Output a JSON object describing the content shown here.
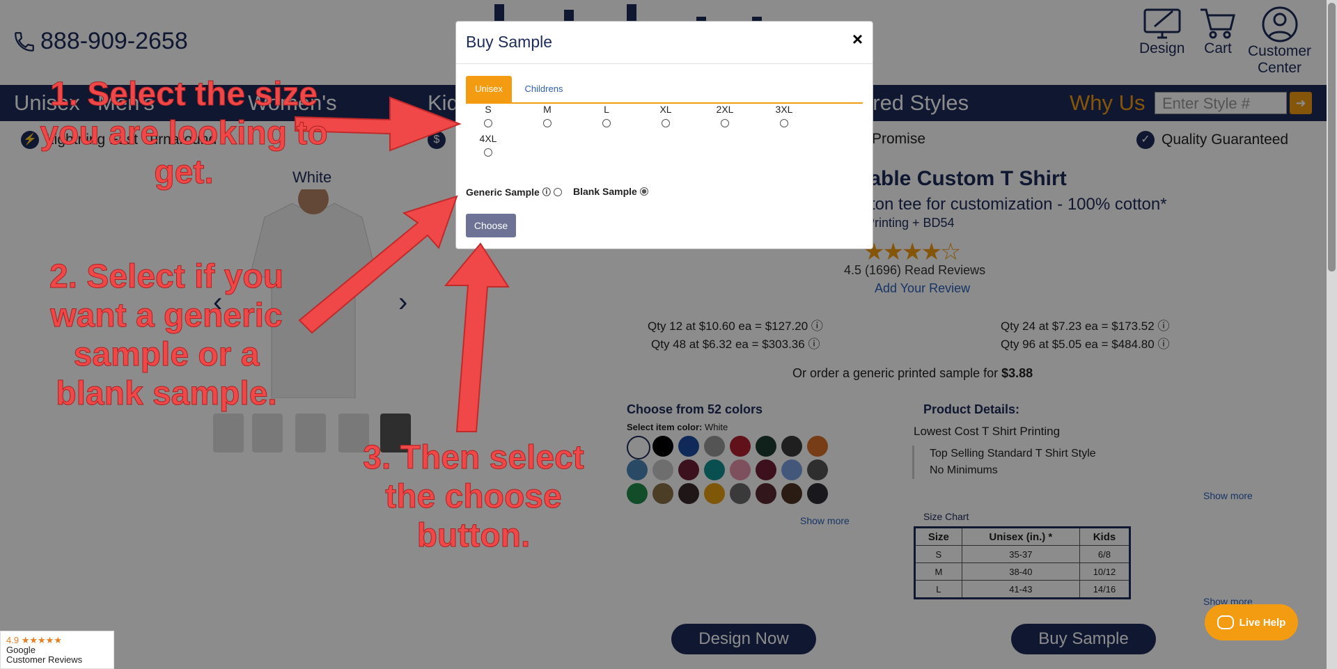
{
  "header": {
    "phone": "888-909-2658",
    "icons": [
      {
        "label": "Design",
        "icon": "design-monitor-icon"
      },
      {
        "label": "Cart",
        "icon": "cart-icon"
      },
      {
        "label_line1": "Customer",
        "label_line2": "Center",
        "icon": "user-icon"
      }
    ]
  },
  "nav": {
    "items": [
      "Unisex",
      "Men's",
      "Women's",
      "Kids",
      "ered Styles"
    ],
    "why_us": "Why Us",
    "search_placeholder": "Enter Style #"
  },
  "benefits": [
    "Lightning Fast Turnaround",
    "Promise",
    "Quality Guaranteed"
  ],
  "product": {
    "color_label": "White",
    "title": "dable Custom T Shirt",
    "subtitle": "otton tee for customization - 100% cotton*",
    "subtitle2": "lt Printing + BD54",
    "rating": 4.5,
    "reviews": "4.5 (1696) Read Reviews",
    "add_review": "Add Your Review",
    "qty_prices": [
      "Qty 12 at $10.60 ea = $127.20",
      "Qty 24 at $7.23 ea = $173.52",
      "Qty 48 at $6.32 ea = $303.36",
      "Qty 96 at $5.05 ea = $484.80"
    ],
    "sample_offer_prefix": "Or order a generic printed sample for ",
    "sample_offer_price": "$3.88",
    "colors_title": "Choose from 52 colors",
    "select_color_label": "Select item color:",
    "select_color_value": "White",
    "show_more": "Show more",
    "swatch_colors": [
      "#ffffff",
      "#000000",
      "#1d4ea0",
      "#9a9a9a",
      "#b0202e",
      "#1e3b30",
      "#3a3a3a",
      "#d8702a",
      "#4c86b8",
      "#c8c8c8",
      "#6a1f35",
      "#139090",
      "#e590a8",
      "#6d1e34",
      "#7a9ee0",
      "#555555",
      "#1e8c4a",
      "#8a7048",
      "#3a2a2a",
      "#e6a010",
      "#6a6a6a",
      "#5a2a34",
      "#4e3422",
      "#2d2d35"
    ],
    "details_title": "Product Details:",
    "details_line": "Lowest Cost T Shirt Printing",
    "details_points": [
      "Top Selling Standard T Shirt Style",
      "No Minimums"
    ],
    "size_chart_label": "Size Chart",
    "size_chart": {
      "headers": [
        "Size",
        "Unisex (in.) *",
        "Kids"
      ],
      "rows": [
        [
          "S",
          "35-37",
          "6/8"
        ],
        [
          "M",
          "38-40",
          "10/12"
        ],
        [
          "L",
          "41-43",
          "14/16"
        ]
      ]
    },
    "design_now": "Design Now",
    "buy_sample": "Buy Sample"
  },
  "live_help": "Live Help",
  "google_badge": {
    "rating": "4.9",
    "line1": "Google",
    "line2": "Customer Reviews"
  },
  "modal": {
    "title": "Buy Sample",
    "close": "×",
    "tabs": [
      "Unisex",
      "Childrens"
    ],
    "sizes": [
      "S",
      "M",
      "L",
      "XL",
      "2XL",
      "3XL",
      "4XL"
    ],
    "generic_sample": "Generic Sample",
    "blank_sample": "Blank Sample",
    "blank_selected": true,
    "choose": "Choose"
  },
  "annotations": {
    "step1": "1. Select the size you are looking to get.",
    "step2": "2. Select if you want a generic sample or a blank sample.",
    "step3": "3. Then select the choose button."
  }
}
